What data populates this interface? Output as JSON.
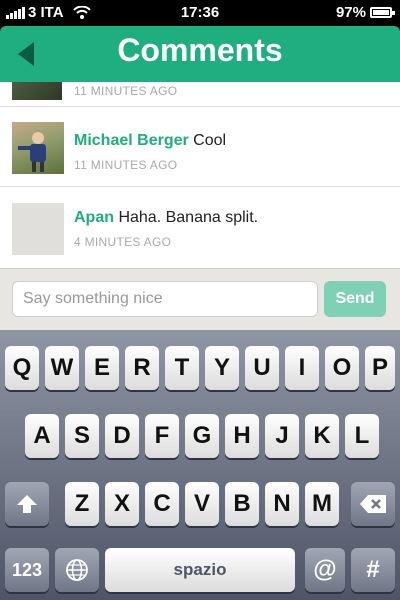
{
  "status_bar": {
    "carrier": "3 ITA",
    "time": "17:36",
    "battery": "97%"
  },
  "header": {
    "title": "Comments"
  },
  "comments": [
    {
      "name": "",
      "text": "",
      "time": "11 MINUTES AGO"
    },
    {
      "name": "Michael Berger",
      "text": "Cool",
      "time": "11 MINUTES AGO"
    },
    {
      "name": "Apan",
      "text": "Haha. Banana split.",
      "time": "4 MINUTES AGO"
    }
  ],
  "composer": {
    "placeholder": "Say something nice",
    "send_label": "Send"
  },
  "keyboard": {
    "row1": [
      "Q",
      "W",
      "E",
      "R",
      "T",
      "Y",
      "U",
      "I",
      "O",
      "P"
    ],
    "row2": [
      "A",
      "S",
      "D",
      "F",
      "G",
      "H",
      "J",
      "K",
      "L"
    ],
    "row3": [
      "Z",
      "X",
      "C",
      "V",
      "B",
      "N",
      "M"
    ],
    "numbers_label": "123",
    "space_label": "spazio",
    "at_label": "@",
    "hash_label": "#"
  }
}
